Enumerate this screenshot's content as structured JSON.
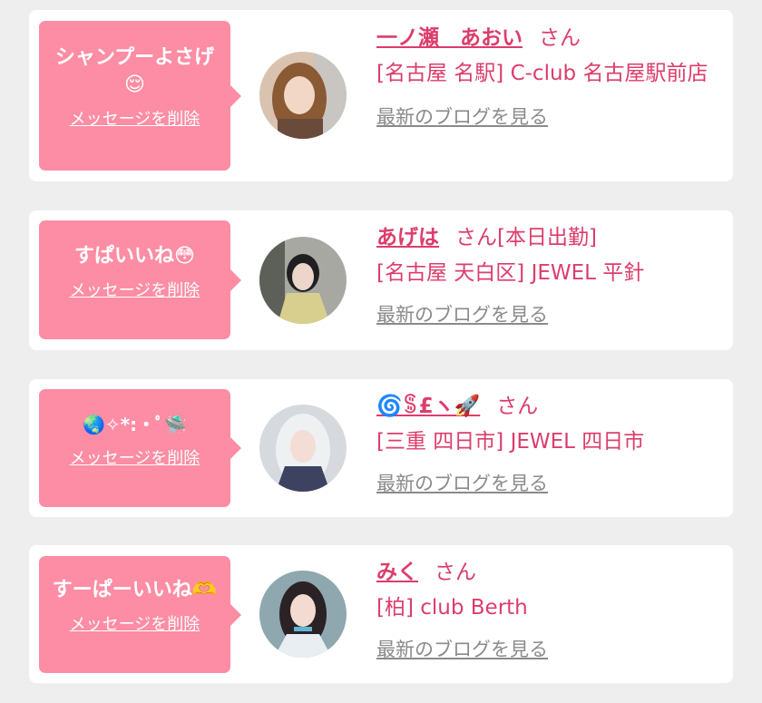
{
  "delete_label": "メッセージを削除",
  "blog_label": "最新のブログを見る",
  "san_label": "さん",
  "colors": {
    "background": "#eeeeee",
    "card": "#ffffff",
    "bubble": "#fc8da4",
    "accent": "#dc3d6b",
    "link_gray": "#8a8a8a"
  },
  "cards": [
    {
      "message": "シャンプーよさげ\n😌",
      "girl_name": "一ノ瀬　あおい",
      "status": "",
      "shop": "[名古屋 名駅] C-club 名古屋駅前店"
    },
    {
      "message": "すぱいいね😳",
      "girl_name": "あげは",
      "status": "[本日出勤]",
      "shop": "[名古屋 天白区] JEWEL 平針"
    },
    {
      "message": "🌏✧*:・ﾟ🛸",
      "girl_name": "🌀ꌚ£ヽ🚀",
      "status": "",
      "shop": "[三重 四日市] JEWEL 四日市"
    },
    {
      "message": "すーぱーいいね🫶",
      "girl_name": "みく",
      "status": "",
      "shop": "[柏] club Berth"
    }
  ]
}
